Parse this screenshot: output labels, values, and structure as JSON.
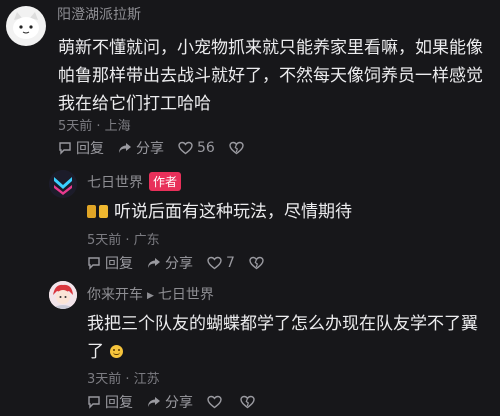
{
  "comments": [
    {
      "username": "阳澄湖派拉斯",
      "lines": [
        "萌新不懂就问，小宠物抓来就只能养家里看嘛，如果能像",
        "帕鲁那样带出去战斗就好了，不然每天像饲养员一样感觉",
        "我在给它们打工哈哈"
      ],
      "meta": "5天前 · 上海",
      "reply_label": "回复",
      "share_label": "分享",
      "like_count": "56",
      "avatar_icon": "cat-face-icon"
    },
    {
      "username": "七日世界",
      "author_badge": "作者",
      "text": "听说后面有这种玩法，尽情期待",
      "meta": "5天前 · 广东",
      "reply_label": "回复",
      "share_label": "分享",
      "like_count": "7",
      "avatar_icon": "game-logo-icon",
      "prefix_icons": [
        "medal-icon",
        "medal-icon"
      ]
    },
    {
      "username": "你来开车",
      "reply_to": "七日世界",
      "lines": [
        "我把三个队友的蝴蝶都学了怎么办现在队友学不了翼",
        "了"
      ],
      "meta": "3天前 · 江苏",
      "reply_label": "回复",
      "share_label": "分享",
      "like_count": "",
      "avatar_icon": "anime-character-icon",
      "emoji_icon": "smile-emoji-icon"
    }
  ],
  "colors": {
    "background": "#17171a",
    "author_badge": "#e8305a",
    "muted_text": "#8e8e93"
  }
}
